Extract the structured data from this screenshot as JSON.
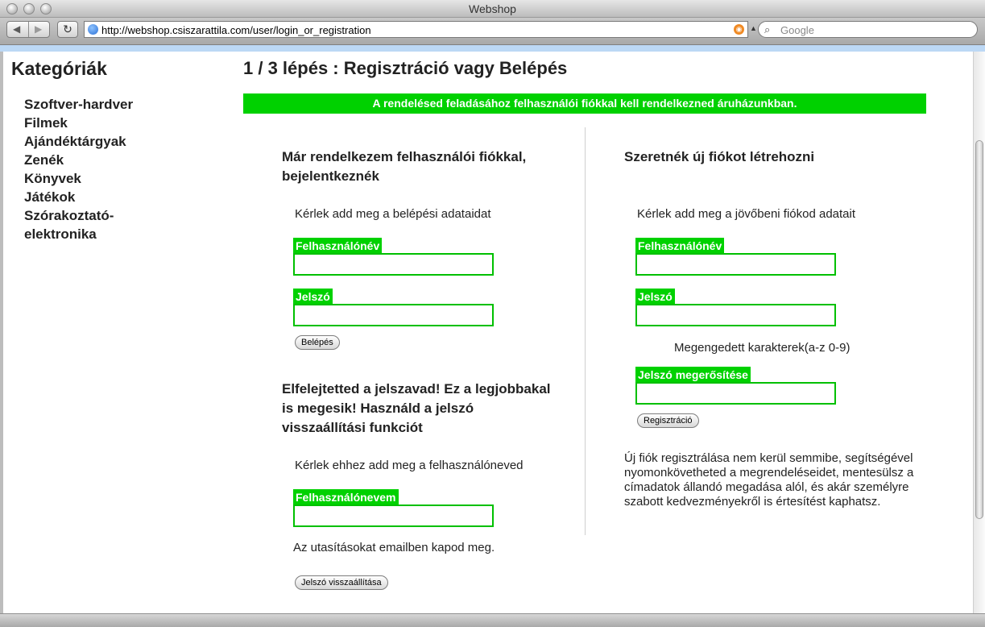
{
  "browser": {
    "window_title": "Webshop",
    "url": "http://webshop.csiszarattila.com/user/login_or_registration",
    "search_placeholder": "Google"
  },
  "sidebar": {
    "heading": "Kategóriák",
    "items": [
      {
        "label": "Szoftver-hardver"
      },
      {
        "label": "Filmek"
      },
      {
        "label": "Ajándéktárgyak"
      },
      {
        "label": "Zenék"
      },
      {
        "label": "Könyvek"
      },
      {
        "label": "Játékok"
      },
      {
        "label": "Szórakoztató-elektronika"
      }
    ]
  },
  "main": {
    "heading": "1 / 3 lépés : Regisztráció vagy Belépés",
    "notice": "A rendelésed feladásához felhasználói fiókkal kell rendelkezned áruházunkban.",
    "login": {
      "title": "Már rendelkezem felhasználói fiókkal, bejelentkeznék",
      "instruction": "Kérlek add meg a belépési adataidat",
      "username_label": "Felhasználónév",
      "password_label": "Jelszó",
      "submit_label": "Belépés"
    },
    "forgot": {
      "title": "Elfelejtetted a jelszavad! Ez a legjobbakal is megesik! Használd a jelszó visszaállítási funkciót",
      "instruction": "Kérlek ehhez add meg a felhasználóneved",
      "username_label": "Felhasználónevem",
      "note": "Az utasításokat emailben kapod meg.",
      "submit_label": "Jelszó visszaállítása"
    },
    "register": {
      "title": "Szeretnék új fiókot létrehozni",
      "instruction": "Kérlek add meg a jövőbeni fiókod adatait",
      "username_label": "Felhasználónév",
      "password_label": "Jelszó",
      "allowed_chars": "Megengedett karakterek(a-z 0-9)",
      "confirm_label": "Jelszó megerősítése",
      "submit_label": "Regisztráció",
      "description": "Új fiók regisztrálása nem kerül semmibe, segítségével nyomonkövetheted a megrendeléseidet, mentesülsz a címadatok állandó megadása alól, és akár személyre szabott kedvezményekről is értesítést kaphatsz."
    }
  },
  "colors": {
    "accent_green": "#00d100",
    "input_border_green": "#00c000"
  }
}
